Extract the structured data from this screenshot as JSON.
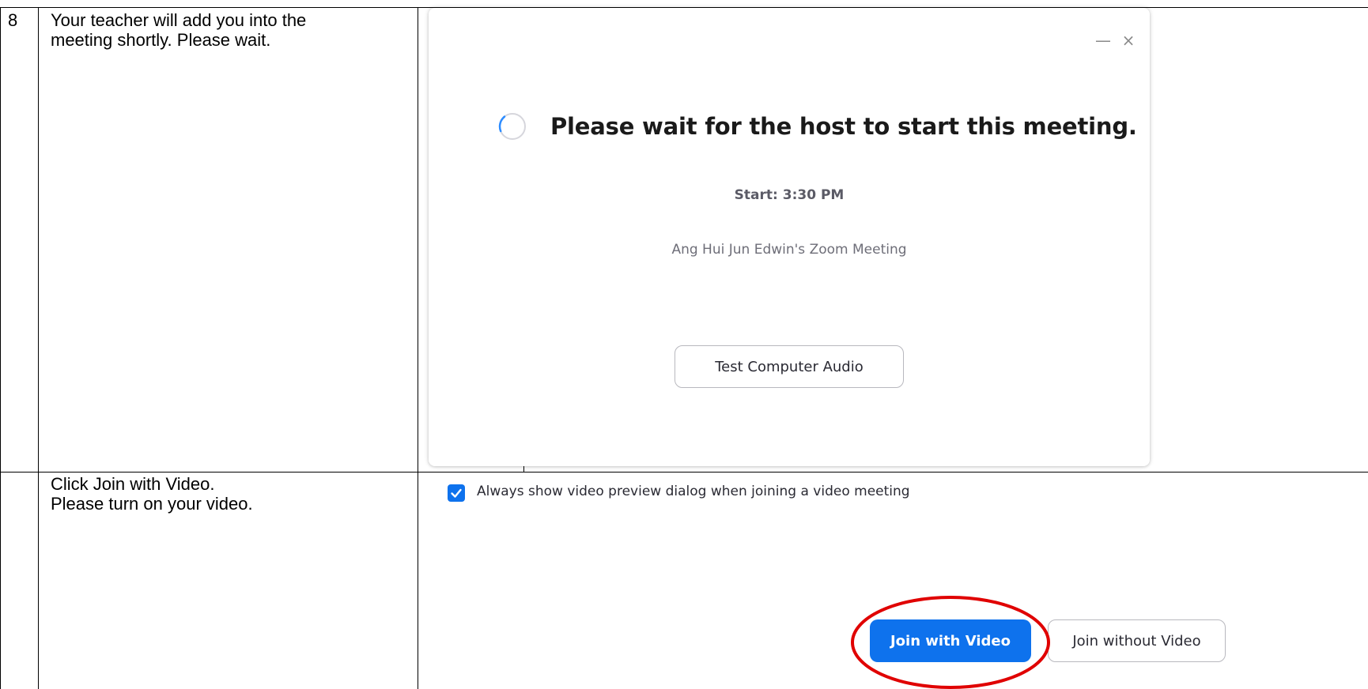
{
  "document": {
    "row1": {
      "number": "8",
      "instruction": "Your teacher will add you into the\nmeeting shortly. Please wait."
    },
    "row2": {
      "number": "",
      "instruction": "Click Join with Video.\nPlease turn on your video."
    }
  },
  "dialog": {
    "minimize_icon": "minimize-icon",
    "close_icon": "close-icon",
    "status_title": "Please wait for the host to start this meeting.",
    "start_time": "Start: 3:30 PM",
    "meeting_name": "Ang Hui Jun Edwin's Zoom Meeting",
    "test_audio_label": "Test Computer Audio"
  },
  "video_preview": {
    "checkbox_checked": true,
    "checkbox_label": "Always show video preview dialog when joining a video meeting",
    "join_with_video_label": "Join with Video",
    "join_without_video_label": "Join without Video"
  },
  "colors": {
    "accent": "#0e72ed",
    "annotation": "#e00000",
    "spinner": "#2d8cff"
  }
}
